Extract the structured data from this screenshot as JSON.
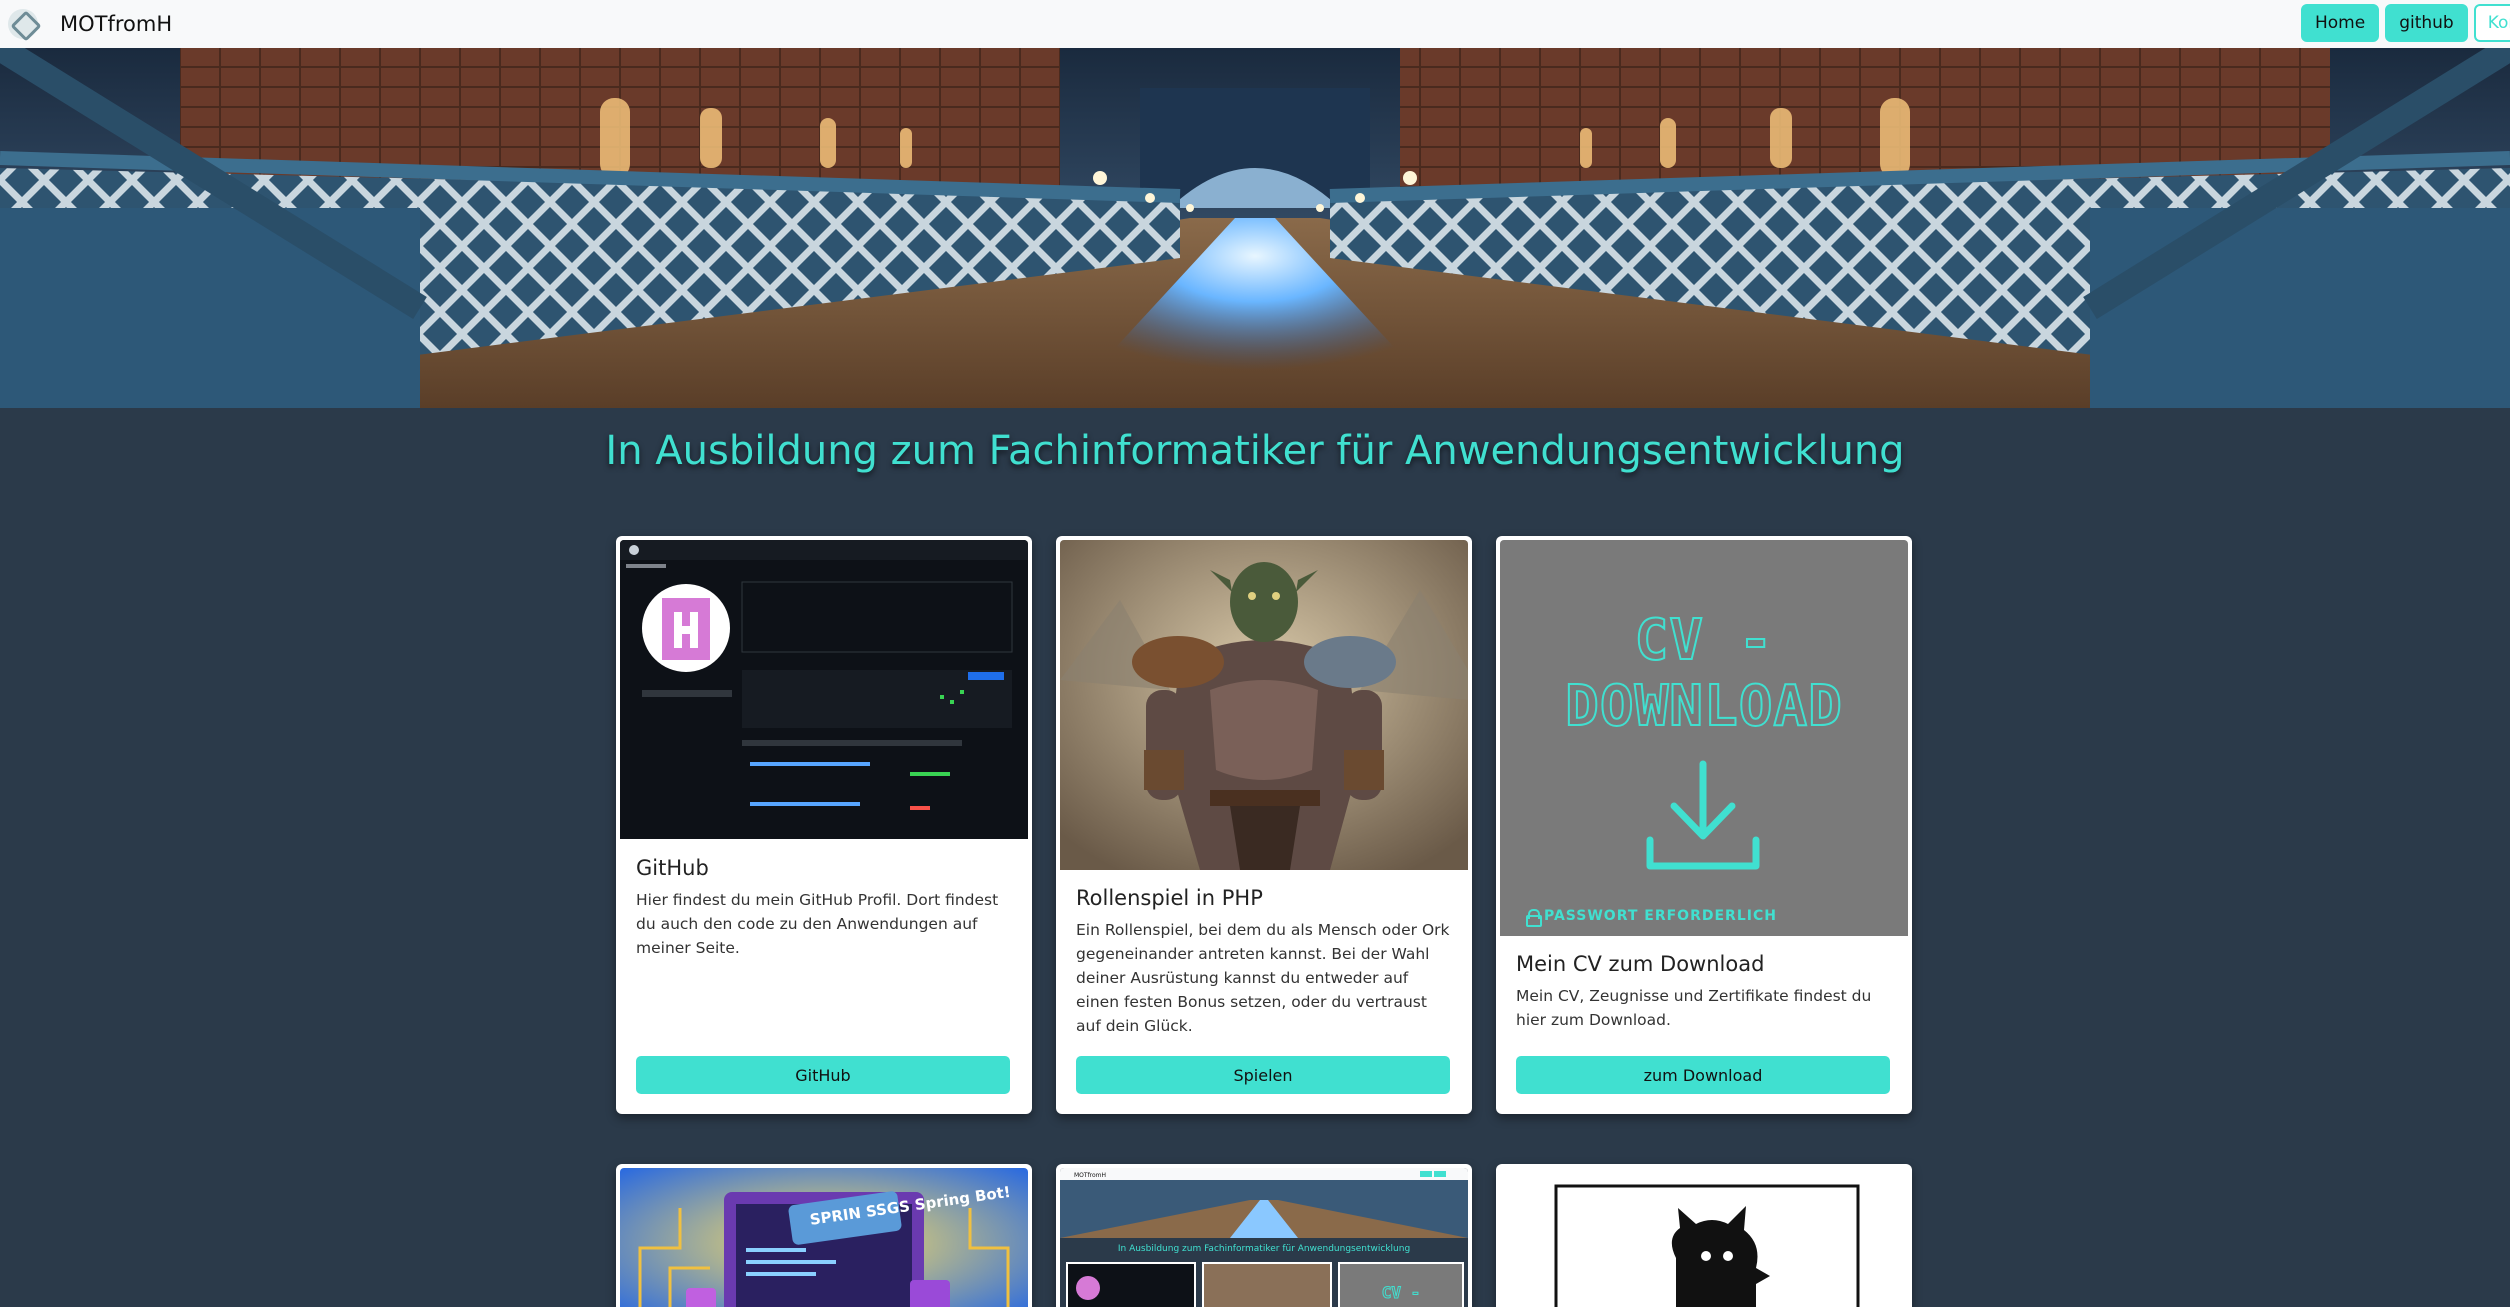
{
  "navbar": {
    "brand": "MOTfromH",
    "links": [
      "Home",
      "github",
      "Kontakt"
    ]
  },
  "headline": "In Ausbildung zum Fachinformatiker für Anwendungsentwicklung",
  "cards": [
    {
      "title": "GitHub",
      "text": "Hier findest du mein GitHub Profil. Dort findest du auch den code zu den Anwendungen auf meiner Seite.",
      "button": "GitHub"
    },
    {
      "title": "Rollenspiel in PHP",
      "text": "Ein Rollenspiel, bei dem du als Mensch oder Ork gegeneinander antreten kannst. Bei der Wahl deiner Ausrüstung kannst du entweder auf einen festen Bonus setzen, oder du vertraust auf dein Glück.",
      "button": "Spielen"
    },
    {
      "title": "Mein CV zum Download",
      "text": "Mein CV, Zeugnisse und Zertifikate findest du hier zum Download.",
      "button": "zum Download",
      "image_heading": "CV - DOWNLOAD",
      "image_note": "PASSWORT ERFORDERLICH"
    }
  ],
  "preview_cards": [
    {
      "image_text": "SPRIN SSGS Spring Bot!"
    },
    {
      "image_brand": "MOTfromH",
      "image_headline": "In Ausbildung zum Fachinformatiker für Anwendungsentwicklung"
    },
    {}
  ],
  "colors": {
    "accent": "#40e0d0",
    "background": "#2b3a4a",
    "navbar": "#f8f9fa"
  }
}
